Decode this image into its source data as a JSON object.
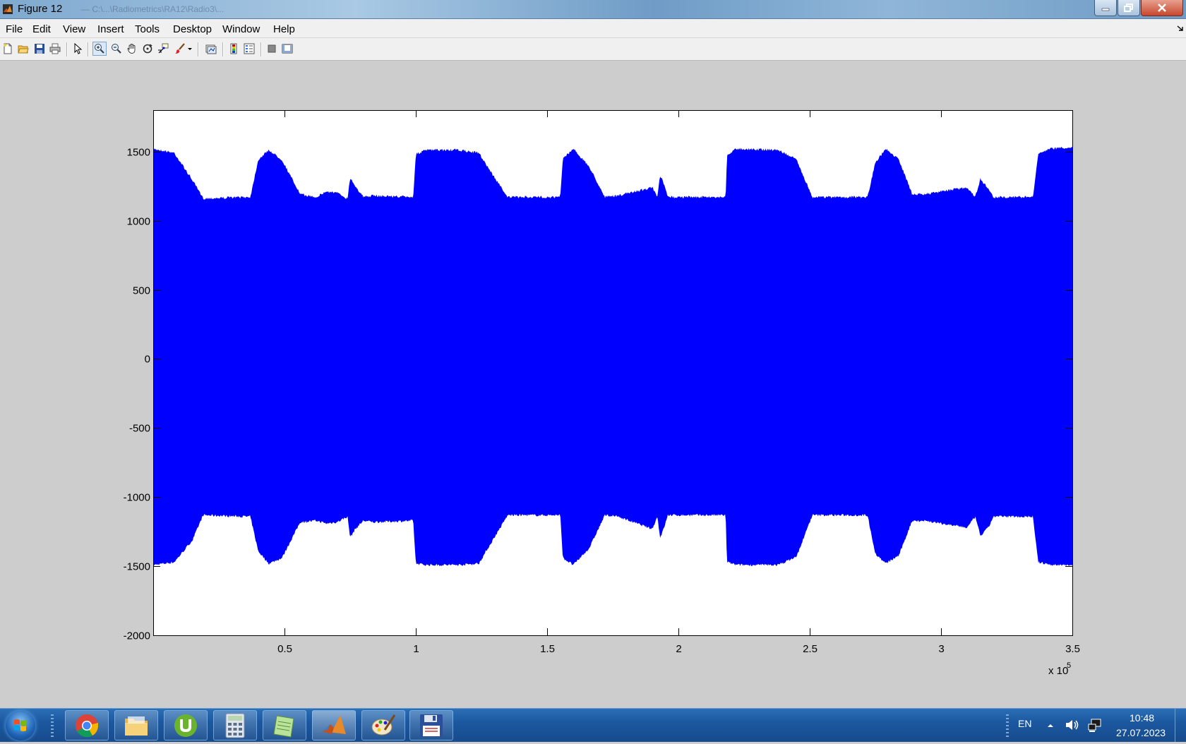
{
  "window": {
    "title": "Figure 12",
    "ghost_title": "— C:\\...\\Radiometrics\\RA12\\Radio3\\..."
  },
  "menu": {
    "items": [
      {
        "id": "file",
        "label": "File"
      },
      {
        "id": "edit",
        "label": "Edit"
      },
      {
        "id": "view",
        "label": "View"
      },
      {
        "id": "insert",
        "label": "Insert"
      },
      {
        "id": "tools",
        "label": "Tools"
      },
      {
        "id": "desktop",
        "label": "Desktop"
      },
      {
        "id": "window",
        "label": "Window"
      },
      {
        "id": "help",
        "label": "Help"
      }
    ]
  },
  "toolbar": {
    "buttons": [
      {
        "name": "new-figure-icon"
      },
      {
        "name": "open-file-icon"
      },
      {
        "name": "save-icon"
      },
      {
        "name": "print-icon"
      },
      {
        "name": "edit-plot-pointer-icon"
      },
      {
        "name": "zoom-in-icon",
        "active": true
      },
      {
        "name": "zoom-out-icon"
      },
      {
        "name": "pan-hand-icon"
      },
      {
        "name": "rotate-3d-icon"
      },
      {
        "name": "data-cursor-icon"
      },
      {
        "name": "brush-icon"
      },
      {
        "name": "link-plot-icon"
      },
      {
        "name": "colorbar-icon"
      },
      {
        "name": "legend-icon"
      },
      {
        "name": "hide-plot-tools-icon"
      },
      {
        "name": "show-plot-tools-icon"
      }
    ]
  },
  "chart_data": {
    "type": "area",
    "title": "",
    "xlabel": "",
    "ylabel": "",
    "x_exponent_label": "x 10",
    "x_exponent": "5",
    "xlim": [
      0,
      350000
    ],
    "ylim": [
      -2000,
      1800
    ],
    "x_ticks": [
      50000,
      100000,
      150000,
      200000,
      250000,
      300000,
      350000
    ],
    "x_tick_labels": [
      "0.5",
      "1",
      "1.5",
      "2",
      "2.5",
      "3",
      "3.5"
    ],
    "y_ticks": [
      1500,
      1000,
      500,
      0,
      -500,
      -1000,
      -1500,
      -2000
    ],
    "y_tick_labels": [
      "1500",
      "1000",
      "500",
      "0",
      "-500",
      "-1000",
      "-1500",
      "-2000"
    ],
    "series": [
      {
        "color": "#0000ff",
        "envelope_x": [
          0,
          8000,
          15000,
          19000,
          35000,
          37000,
          40000,
          44000,
          49000,
          56000,
          62000,
          66000,
          70000,
          74000,
          75000,
          77000,
          80000,
          84000,
          99000,
          100000,
          104000,
          116000,
          124000,
          129000,
          135000,
          138000,
          155000,
          156000,
          160000,
          166000,
          172000,
          177000,
          190000,
          192000,
          193000,
          194000,
          196000,
          199000,
          218000,
          218500,
          222000,
          238000,
          245000,
          251000,
          254000,
          272000,
          275000,
          279000,
          284000,
          289000,
          294000,
          300000,
          310000,
          313000,
          315000,
          318000,
          320000,
          335000,
          337000,
          342000,
          350000
        ],
        "envelope_upper": [
          1530,
          1500,
          1300,
          1170,
          1180,
          1180,
          1450,
          1520,
          1450,
          1200,
          1180,
          1220,
          1210,
          1170,
          1320,
          1260,
          1180,
          1190,
          1180,
          1490,
          1520,
          1520,
          1500,
          1350,
          1180,
          1180,
          1180,
          1460,
          1530,
          1400,
          1180,
          1190,
          1250,
          1180,
          1330,
          1300,
          1180,
          1180,
          1180,
          1480,
          1530,
          1520,
          1450,
          1180,
          1180,
          1180,
          1430,
          1530,
          1450,
          1200,
          1200,
          1220,
          1250,
          1180,
          1310,
          1240,
          1180,
          1180,
          1490,
          1530,
          1540
        ],
        "envelope_lower": [
          -1500,
          -1480,
          -1320,
          -1140,
          -1150,
          -1150,
          -1400,
          -1490,
          -1450,
          -1190,
          -1180,
          -1200,
          -1190,
          -1150,
          -1300,
          -1240,
          -1180,
          -1190,
          -1180,
          -1490,
          -1500,
          -1500,
          -1490,
          -1330,
          -1140,
          -1140,
          -1140,
          -1450,
          -1500,
          -1380,
          -1140,
          -1150,
          -1240,
          -1150,
          -1300,
          -1260,
          -1140,
          -1140,
          -1140,
          -1480,
          -1500,
          -1500,
          -1440,
          -1140,
          -1140,
          -1140,
          -1420,
          -1490,
          -1430,
          -1180,
          -1180,
          -1200,
          -1230,
          -1150,
          -1290,
          -1230,
          -1150,
          -1150,
          -1480,
          -1500,
          -1500
        ]
      }
    ]
  },
  "taskbar": {
    "apps": [
      {
        "name": "chrome-icon"
      },
      {
        "name": "file-explorer-icon"
      },
      {
        "name": "utorrent-icon"
      },
      {
        "name": "calculator-icon"
      },
      {
        "name": "notepad-icon"
      },
      {
        "name": "matlab-icon",
        "active": true
      },
      {
        "name": "paint-icon"
      },
      {
        "name": "floppy-save-icon"
      }
    ],
    "language": "EN",
    "time": "10:48",
    "date": "27.07.2023"
  }
}
